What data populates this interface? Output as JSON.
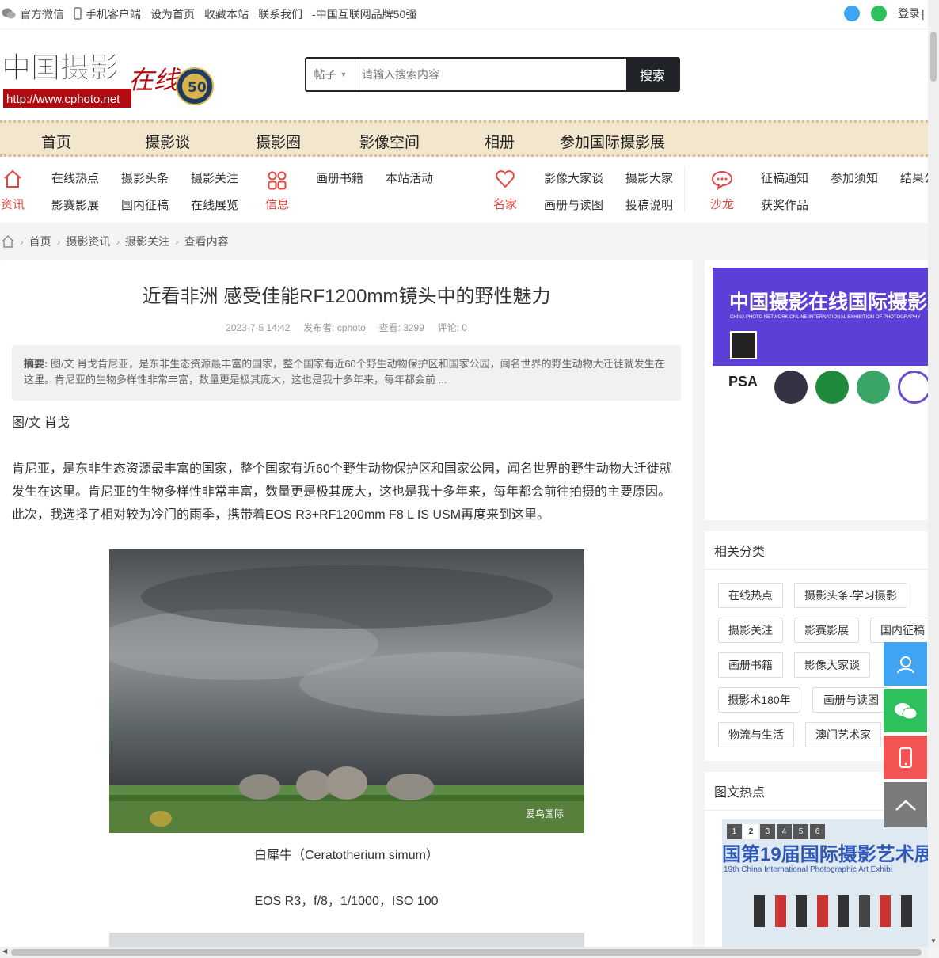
{
  "topbar": {
    "wechat": "官方微信",
    "mobile": "手机客户端",
    "homepage": "设为首页",
    "favorite": "收藏本站",
    "contact": "联系我们",
    "brand": "-中国互联网品牌50强",
    "login": "登录"
  },
  "logo": {
    "main": "中国摄影",
    "script": "在线",
    "url": "http://www.cphoto.net",
    "badge": "50"
  },
  "search": {
    "scope": "帖子",
    "placeholder": "请输入搜索内容",
    "button": "搜索"
  },
  "nav": [
    "首页",
    "摄影谈",
    "摄影圈",
    "影像空间",
    "相册",
    "参加国际摄影展"
  ],
  "subnav": {
    "g1": {
      "label": "资讯",
      "links": [
        "在线热点",
        "摄影头条",
        "摄影关注",
        "影赛影展",
        "国内征稿",
        "在线展览"
      ]
    },
    "g2": {
      "label": "信息",
      "links": [
        "画册书籍",
        "本站活动"
      ]
    },
    "g3": {
      "label": "名家",
      "links": [
        "影像大家谈",
        "摄影大家",
        "画册与读图",
        "投稿说明"
      ]
    },
    "g4": {
      "label": "沙龙",
      "links": [
        "征稿通知",
        "参加须知",
        "结果公",
        "获奖作品"
      ]
    }
  },
  "breadcrumb": [
    "首页",
    "摄影资讯",
    "摄影关注",
    "查看内容"
  ],
  "article": {
    "title": "近看非洲 感受佳能RF1200mm镜头中的野性魅力",
    "date": "2023-7-5 14:42",
    "author": "发布者: cphoto",
    "views": "查看: 3299",
    "comments": "评论: 0",
    "summary_label": "摘要:",
    "summary": "图/文 肖戈肯尼亚，是东非生态资源最丰富的国家，整个国家有近60个野生动物保护区和国家公园，闻名世界的野生动物大迁徙就发生在这里。肯尼亚的生物多样性非常丰富，数量更是极其庞大，这也是我十多年来，每年都会前 ...",
    "byline": "图/文 肖戈",
    "body": "肯尼亚，是东非生态资源最丰富的国家，整个国家有近60个野生动物保护区和国家公园，闻名世界的野生动物大迁徙就发生在这里。肯尼亚的生物多样性非常丰富，数量更是极其庞大，这也是我十多年来，每年都会前往拍摄的主要原因。此次，我选择了相对较为冷门的雨季，携带着EOS R3+RF1200mm F8 L IS USM再度来到这里。",
    "photo_watermark": "爱鸟国际",
    "caption1": "白犀牛（Ceratotherium simum）",
    "caption2": "EOS R3，f/8，1/1000，ISO 100"
  },
  "side_banner": {
    "title": "中国摄影在线国际摄影展",
    "subtitle": "CHINA PHOTO NETWORK ONLINE INTERNATIONAL EXHIBITION OF PHOTOGRAPHY",
    "psa": "PSA"
  },
  "related": {
    "title": "相关分类",
    "tags": [
      "在线热点",
      "摄影头条-学习摄影",
      "摄影关注",
      "影赛影展",
      "国内征稿",
      "画册书籍",
      "影像大家谈",
      "摄影术180年",
      "画册与读图",
      "物流与生活",
      "澳门艺术家"
    ]
  },
  "hot": {
    "title": "图文热点",
    "pages": [
      "1",
      "2",
      "3",
      "4",
      "5",
      "6"
    ],
    "banner_text": "国第19届国际摄影艺术展",
    "banner_sub": "19th China International Photographic Art Exhibi"
  },
  "colors": {
    "accent": "#e5463e",
    "nav_bg": "#f2e6cd",
    "float_blue": "#3fa4f4",
    "float_green": "#2ec05c",
    "float_red": "#f25454",
    "float_gray": "#7b7b7b"
  }
}
